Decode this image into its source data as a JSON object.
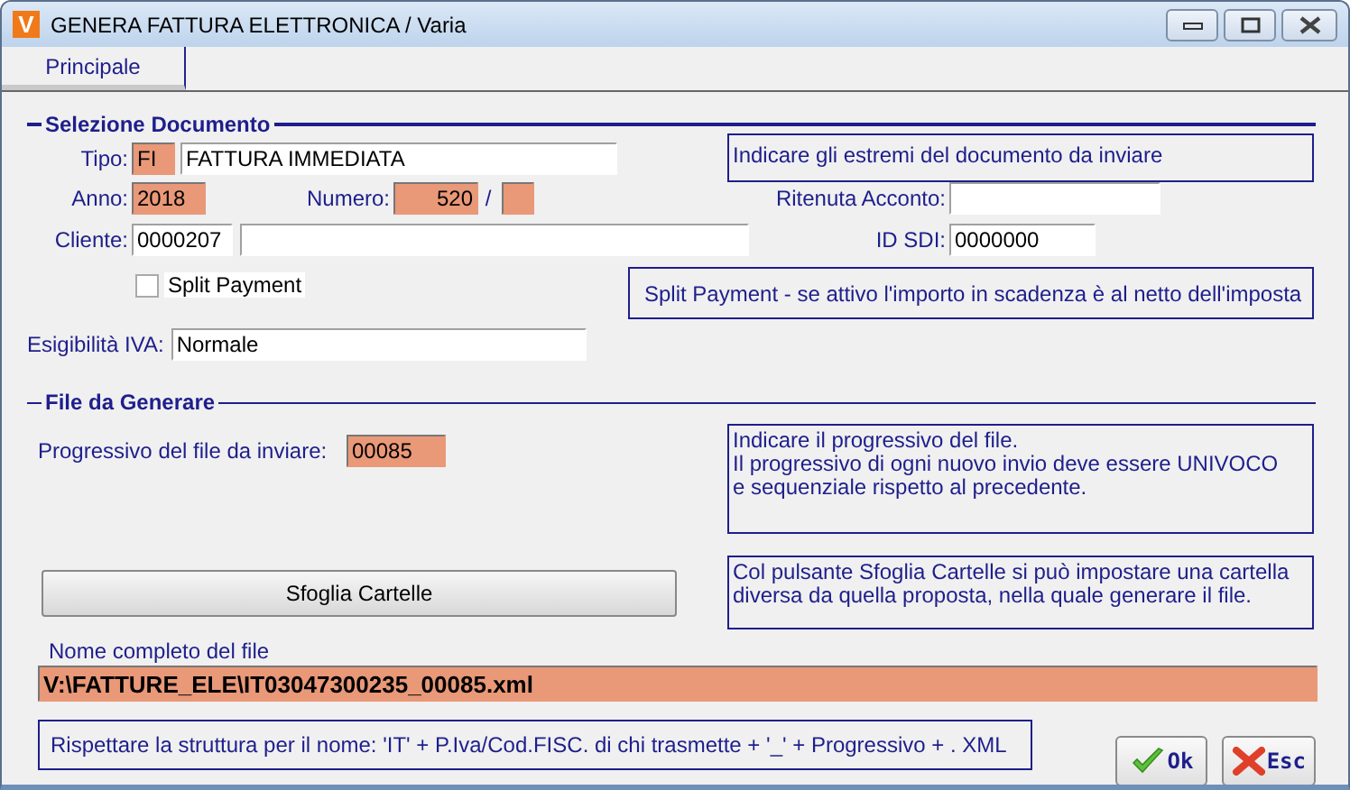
{
  "window": {
    "logo": "V",
    "title": "GENERA FATTURA ELETTRONICA / Varia"
  },
  "tabs": [
    {
      "label": "Principale",
      "selected": true
    }
  ],
  "documento": {
    "heading": "Selezione Documento",
    "tipo": {
      "label": "Tipo:",
      "code": "FI",
      "description": "FATTURA IMMEDIATA"
    },
    "info": "Indicare gli estremi del documento da inviare",
    "anno": {
      "label": "Anno:",
      "value": "2018"
    },
    "numero": {
      "label": "Numero:",
      "value": "520",
      "separator": "/"
    },
    "ritenuta": {
      "label": "Ritenuta Acconto:"
    },
    "cliente": {
      "label": "Cliente:",
      "code": "0000207"
    },
    "id_sdi": {
      "label": "ID SDI:",
      "value": "0000000"
    },
    "split_payment": {
      "label": "Split Payment",
      "checked": false
    },
    "split_info": "Split Payment - se attivo l'importo in scadenza è al netto dell'imposta",
    "esigibilita": {
      "label": "Esigibilità IVA:",
      "value": "Normale"
    }
  },
  "file": {
    "heading": "File da Generare",
    "progressivo": {
      "label": "Progressivo del file da inviare:",
      "value": "00085"
    },
    "progressivo_info": [
      "Indicare il progressivo del file.",
      "Il progressivo di ogni nuovo invio deve essere UNIVOCO",
      "e sequenziale rispetto al precedente."
    ],
    "browse_button": "Sfoglia Cartelle",
    "browse_info": [
      "Col pulsante Sfoglia Cartelle si può impostare una cartella",
      "diversa da quella proposta, nella quale generare il file."
    ],
    "full_name_label": "Nome completo del file",
    "full_name": "V:\\FATTURE_ELE\\IT03047300235_00085.xml",
    "rule": "Rispettare la struttura per il nome:  'IT' +  P.Iva/Cod.FISC. di chi trasmette  + '_' + Progressivo + . XML"
  },
  "buttons": [
    {
      "kind": "ok",
      "label": "Ok"
    },
    {
      "kind": "esc",
      "label": "Esc"
    }
  ]
}
